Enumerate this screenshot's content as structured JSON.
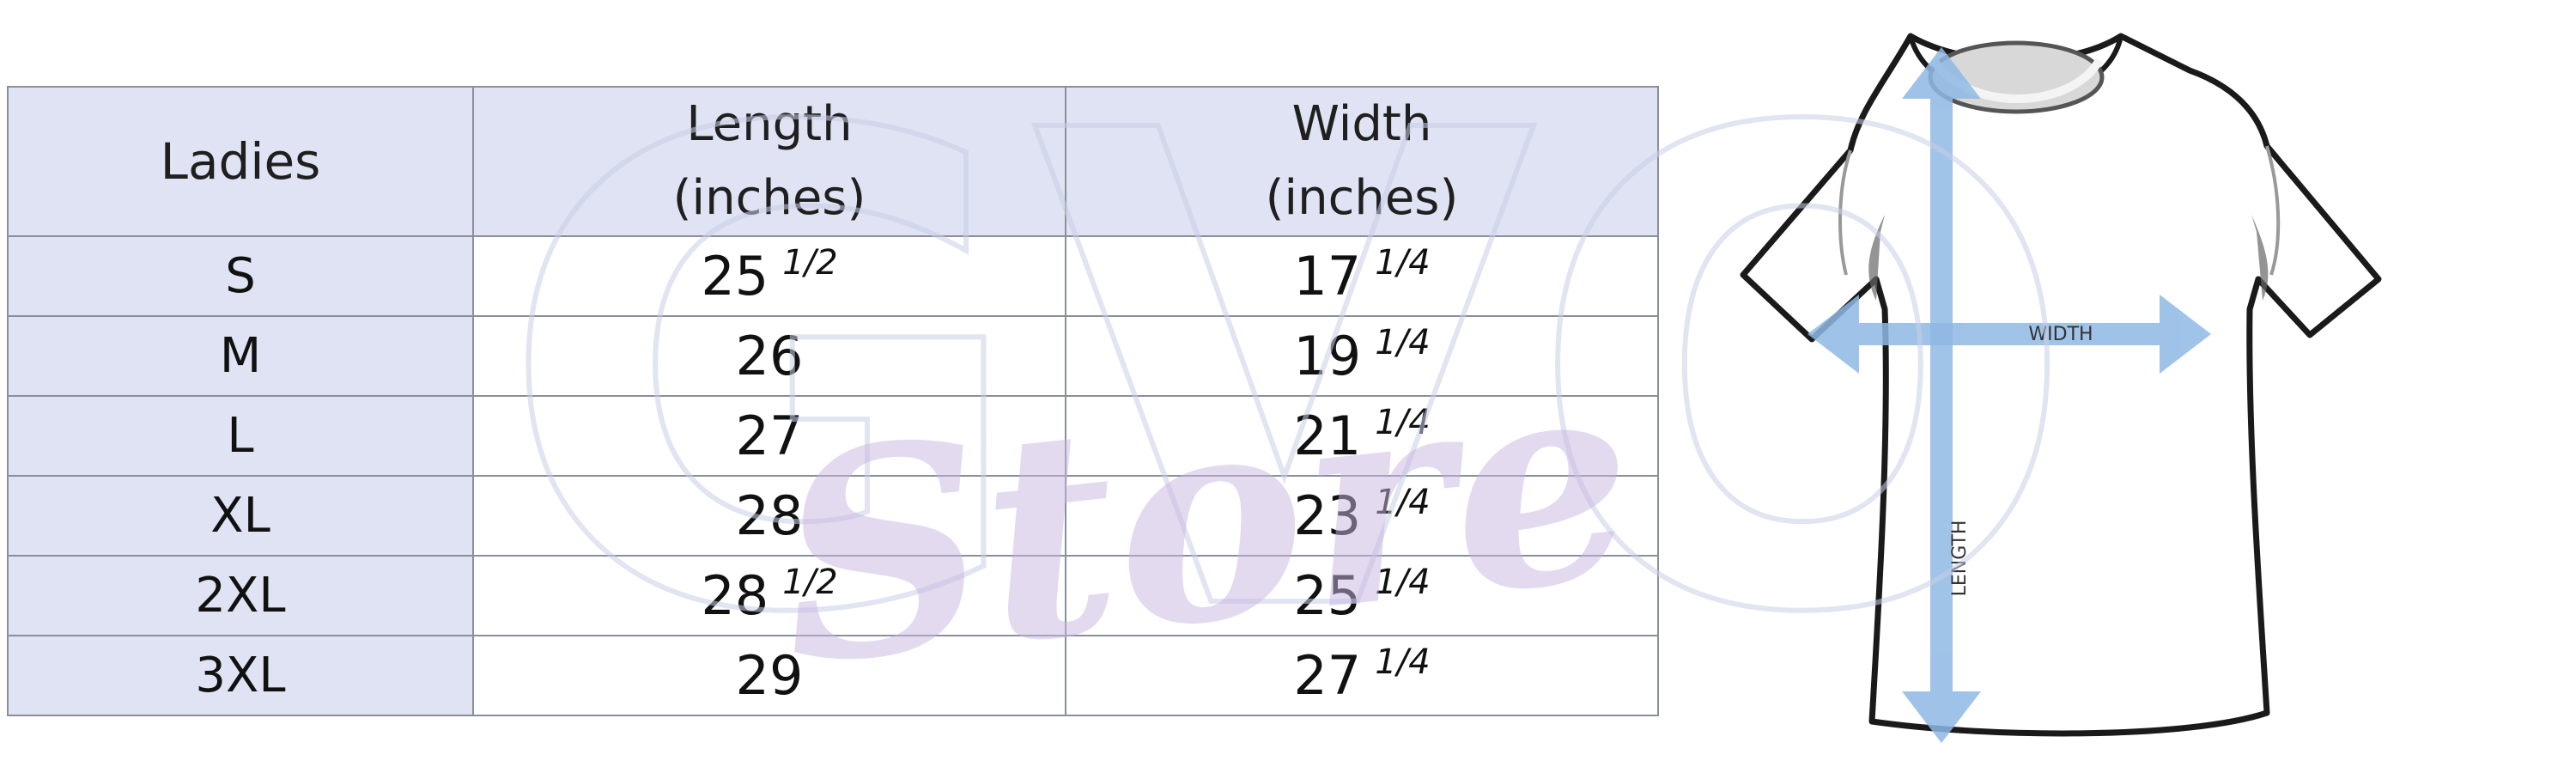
{
  "table": {
    "headers": {
      "size": "Ladies",
      "length_line1": "Length",
      "length_line2": "(inches)",
      "width_line1": "Width",
      "width_line2": "(inches)"
    },
    "rows": [
      {
        "size": "S",
        "length": "25",
        "length_frac": "1/2",
        "width": "17",
        "width_frac": "1/4"
      },
      {
        "size": "M",
        "length": "26",
        "length_frac": "",
        "width": "19",
        "width_frac": "1/4"
      },
      {
        "size": "L",
        "length": "27",
        "length_frac": "",
        "width": "21",
        "width_frac": "1/4"
      },
      {
        "size": "XL",
        "length": "28",
        "length_frac": "",
        "width": "23",
        "width_frac": "1/4"
      },
      {
        "size": "2XL",
        "length": "28",
        "length_frac": "1/2",
        "width": "25",
        "width_frac": "1/4"
      },
      {
        "size": "3XL",
        "length": "29",
        "length_frac": "",
        "width": "27",
        "width_frac": "1/4"
      }
    ]
  },
  "diagram": {
    "width_label": "WIDTH",
    "length_label": "LENGTH",
    "arrow_color": "#8fb8e4"
  },
  "watermark": {
    "text_main": "GVO",
    "text_script": "Store"
  }
}
